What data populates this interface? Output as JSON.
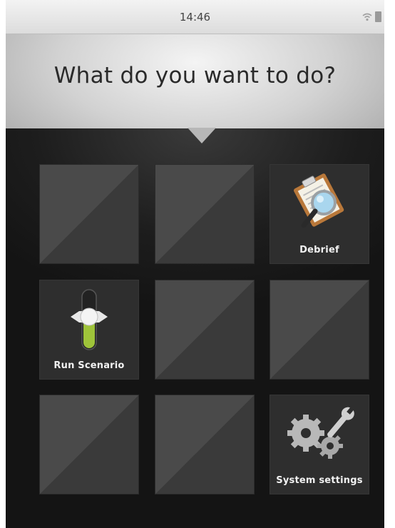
{
  "status_bar": {
    "time": "14:46",
    "icons": [
      "wifi-icon",
      "battery-icon"
    ]
  },
  "header": {
    "title": "What do you want to do?"
  },
  "tiles": [
    {
      "label": "",
      "icon": null
    },
    {
      "label": "",
      "icon": null
    },
    {
      "label": "Debrief",
      "icon": "clipboard-magnifier-icon"
    },
    {
      "label": "Run Scenario",
      "icon": "slider-toggle-icon"
    },
    {
      "label": "",
      "icon": null
    },
    {
      "label": "",
      "icon": null
    },
    {
      "label": "",
      "icon": null
    },
    {
      "label": "",
      "icon": null
    },
    {
      "label": "System settings",
      "icon": "gears-wrench-icon"
    }
  ],
  "colors": {
    "accent_green": "#9fc43a",
    "tile": "#4a4a4a",
    "background": "#161616"
  }
}
